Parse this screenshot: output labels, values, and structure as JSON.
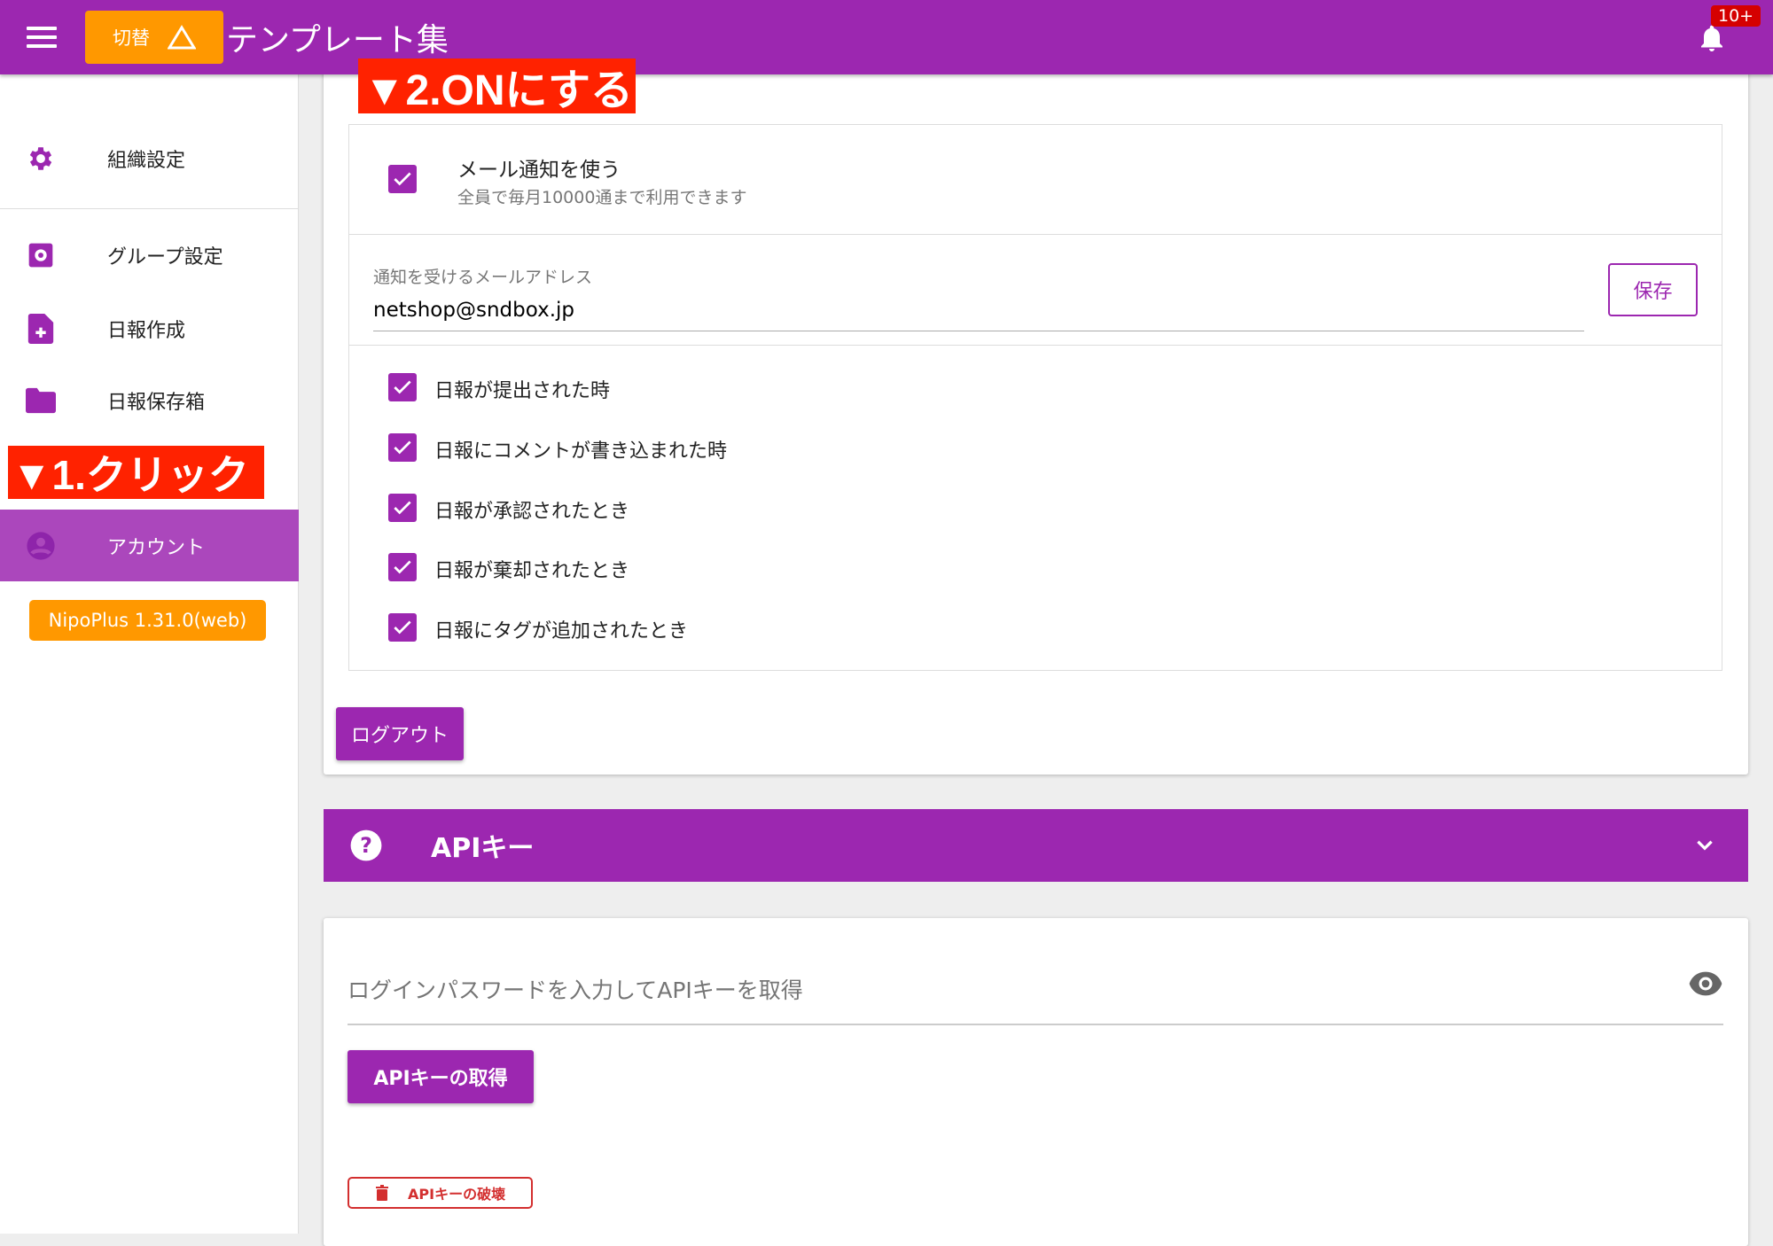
{
  "header": {
    "switch_label": "切替",
    "switch_icon": "triangle-up-outline",
    "title": "テンプレート集",
    "notification_badge": "10+"
  },
  "sidebar": {
    "items": [
      {
        "label": "組織設定",
        "icon": "gear-icon"
      },
      {
        "label": "グループ設定",
        "icon": "gear-box-icon"
      },
      {
        "label": "日報作成",
        "icon": "file-plus-icon"
      },
      {
        "label": "日報保存箱",
        "icon": "folder-icon"
      },
      {
        "label": "アカウント",
        "icon": "account-circle-icon",
        "active": true
      }
    ],
    "version": "NipoPlus 1.31.0(web)"
  },
  "annotations": {
    "step1": "▼1.クリック",
    "step2": "▼2.ONにする"
  },
  "mail": {
    "enable_label": "メール通知を使う",
    "enable_sub": "全員で毎月10000通まで利用できます",
    "enabled": true,
    "address_label": "通知を受けるメールアドレス",
    "address_value": "netshop@sndbox.jp",
    "save_label": "保存",
    "options": [
      {
        "label": "日報が提出された時",
        "checked": true
      },
      {
        "label": "日報にコメントが書き込まれた時",
        "checked": true
      },
      {
        "label": "日報が承認されたとき",
        "checked": true
      },
      {
        "label": "日報が棄却されたとき",
        "checked": true
      },
      {
        "label": "日報にタグが追加されたとき",
        "checked": true
      }
    ]
  },
  "logout_label": "ログアウト",
  "api": {
    "title": "APIキー",
    "password_placeholder": "ログインパスワードを入力してAPIキーを取得",
    "get_label": "APIキーの取得",
    "destroy_label": "APIキーの破壊"
  },
  "colors": {
    "primary": "#9c27b0",
    "accent": "#ff9800",
    "annotation": "#ff2200",
    "danger": "#d32f2f"
  }
}
